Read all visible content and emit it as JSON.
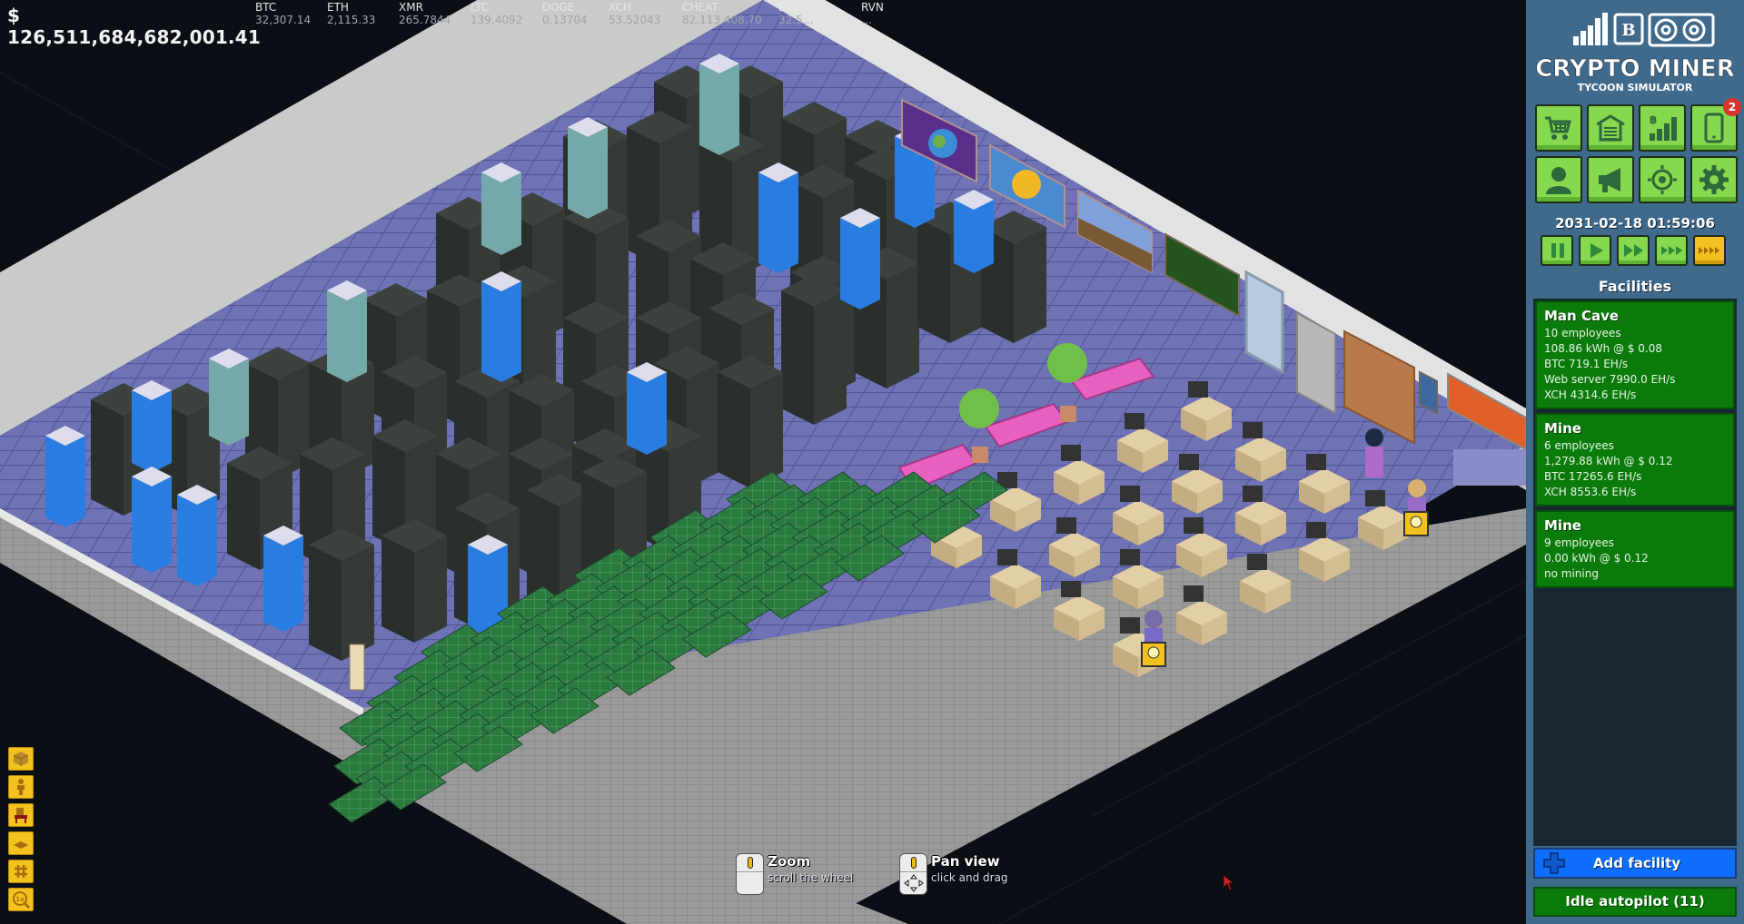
{
  "balance": "$ 126,511,684,682,001.41",
  "ticker": [
    {
      "symbol": "BTC",
      "price": "32,307.14"
    },
    {
      "symbol": "ETH",
      "price": "2,115.33"
    },
    {
      "symbol": "XMR",
      "price": "265.7844"
    },
    {
      "symbol": "LTC",
      "price": "139.4092"
    },
    {
      "symbol": "DOGE",
      "price": "0.13704"
    },
    {
      "symbol": "XCH",
      "price": "53.52043"
    },
    {
      "symbol": "CHEAT",
      "price": "82,113,408.70"
    },
    {
      "symbol": "ETC",
      "price": "32.5…"
    },
    {
      "symbol": "RVN",
      "price": "…"
    }
  ],
  "logo": {
    "line1": "CRYPTO MINER",
    "line2": "TYCOON SIMULATOR"
  },
  "menu_buttons": [
    {
      "name": "shop",
      "icon": "cart-icon"
    },
    {
      "name": "facilities",
      "icon": "garage-icon"
    },
    {
      "name": "market",
      "icon": "bitcoin-chart-icon"
    },
    {
      "name": "phone",
      "icon": "phone-icon",
      "badge": "2"
    },
    {
      "name": "employees",
      "icon": "person-icon"
    },
    {
      "name": "marketing",
      "icon": "megaphone-icon"
    },
    {
      "name": "targets",
      "icon": "crosshair-icon"
    },
    {
      "name": "settings",
      "icon": "gear-icon"
    }
  ],
  "clock": "2031-02-18 01:59:06",
  "speeds": [
    {
      "name": "pause",
      "icon": "pause-icon",
      "active": false
    },
    {
      "name": "play",
      "icon": "play-icon",
      "active": false
    },
    {
      "name": "fast",
      "icon": "fast-forward-icon",
      "active": false
    },
    {
      "name": "faster",
      "icon": "faster-forward-icon",
      "active": false
    },
    {
      "name": "fastest",
      "icon": "fastest-forward-icon",
      "active": true
    }
  ],
  "facilities_title": "Facilities",
  "facilities": [
    {
      "name": "Man Cave",
      "lines": [
        "10 employees",
        "108.86 kWh @ $ 0.08",
        "BTC 719.1 EH/s",
        "Web server 7990.0 EH/s",
        "XCH 4314.6 EH/s"
      ]
    },
    {
      "name": "Mine",
      "lines": [
        "6 employees",
        "1,279.88 kWh @ $ 0.12",
        "BTC 17265.6 EH/s",
        "XCH 8553.6 EH/s"
      ]
    },
    {
      "name": "Mine",
      "lines": [
        "9 employees",
        "0.00 kWh @ $ 0.12",
        "no mining"
      ]
    }
  ],
  "add_facility_label": "Add facility",
  "autopilot_label": "Idle autopilot (11)",
  "tools": [
    {
      "name": "walls-toggle",
      "icon": "cube-icon"
    },
    {
      "name": "people-toggle",
      "icon": "person-figure-icon"
    },
    {
      "name": "furniture-toggle",
      "icon": "chair-icon"
    },
    {
      "name": "floor-toggle",
      "icon": "floor-tile-icon"
    },
    {
      "name": "grid-toggle",
      "icon": "grid-hash-icon"
    },
    {
      "name": "zoom-reset",
      "icon": "zoom-1x-icon",
      "text": "1x"
    }
  ],
  "hints": {
    "zoom": {
      "title": "Zoom",
      "sub": "scroll the wheel"
    },
    "pan": {
      "title": "Pan view",
      "sub": "click and drag"
    }
  },
  "colors": {
    "panel_bg": "#3f6a8c",
    "button_green": "#86d84e",
    "active_speed": "#f3c11f",
    "facility_green": "#0a7a0a",
    "add_blue": "#0d6efb",
    "badge_red": "#d9342f",
    "floor": "#6f72b4",
    "wall": "#c9c9c9"
  }
}
